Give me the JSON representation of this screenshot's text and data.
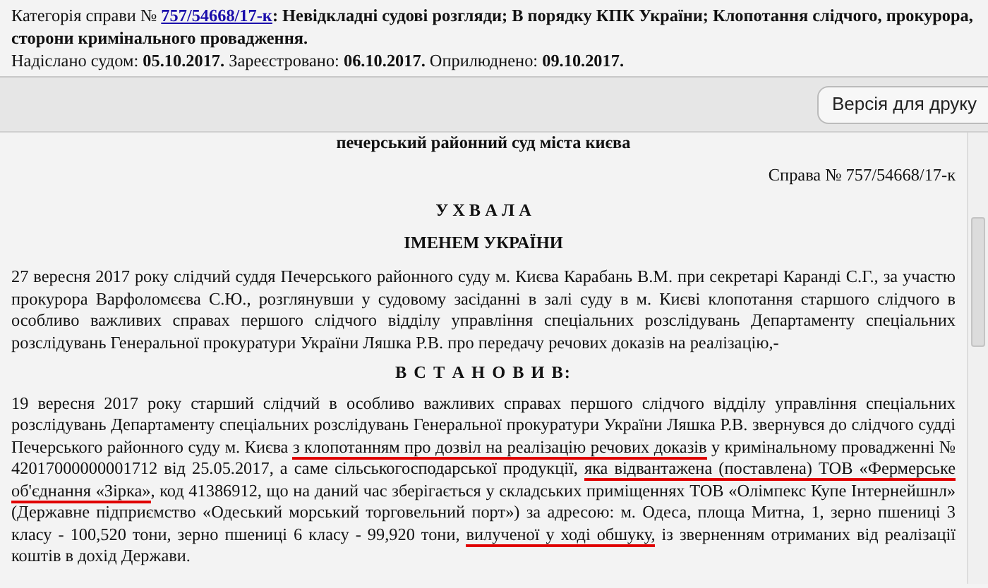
{
  "case_header": {
    "category_label": "Категорія справи №",
    "case_link": "757/54668/17-к",
    "category_text": ": Невідкладні судові розгляди; В порядку КПК України; Клопотання слідчого, прокурора, сторони кримінального провадження.",
    "dates": [
      {
        "label": "Надіслано судом:",
        "value": "05.10.2017."
      },
      {
        "label": "Зареєстровано:",
        "value": "06.10.2017."
      },
      {
        "label": "Оприлюднено:",
        "value": "09.10.2017."
      }
    ]
  },
  "print_button": "Версія для друку",
  "document": {
    "court": "печерський районний суд міста києва",
    "case_number": "Справа № 757/54668/17-к",
    "title": "У Х В А Л А",
    "subtitle": "ІМЕНЕМ УКРАЇНИ",
    "intro": "27 вересня 2017 року слідчий суддя Печерського районного суду м. Києва Карабань В.М. при секретарі Каранді С.Г., за участю прокурора Варфоломєєва С.Ю., розглянувши у судовому засіданні в залі суду в м. Києві клопотання старшого слідчого в особливо важливих справах першого слідчого відділу управління спеціальних розслідувань Департаменту спеціальних розслідувань Генеральної прокуратури України Ляшка Р.В. про передачу речових доказів на реалізацію,-",
    "heading": "В С Т А Н О В И В:",
    "body": [
      {
        "text": "19 вересня 2017 року старший слідчий в особливо важливих справах першого слідчого відділу управління спеціальних розслідувань Департаменту спеціальних розслідувань Генеральної прокуратури України Ляшка Р.В. звернувся до слідчого судді Печерського районного суду м. Києва ",
        "underlined": false
      },
      {
        "text": "з клопотанням про дозвіл на реалізацію речових доказів",
        "underlined": true
      },
      {
        "text": " у кримінальному провадженні № 42017000000001712 від 25.05.2017, а саме сільськогосподарської продукції, ",
        "underlined": false
      },
      {
        "text": "яка відвантажена (поставлена) ТОВ «Фермерське об'єднання «Зірка»",
        "underlined": true
      },
      {
        "text": ", код 41386912, що на даний час зберігається у складських приміщеннях ТОВ «Олімпекс Купе Інтернейшнл» (Державне підприємство «Одеський морський торговельний порт») за адресою: м. Одеса, площа Митна, 1, зерно пшениці 3 класу - 100,520 тони, зерно пшениці 6 класу - 99,920 тони, ",
        "underlined": false
      },
      {
        "text": "вилученої у ході обшуку,",
        "underlined": true
      },
      {
        "text": " із зверненням отриманих від реалізації коштів в дохід Держави.",
        "underlined": false
      }
    ]
  }
}
